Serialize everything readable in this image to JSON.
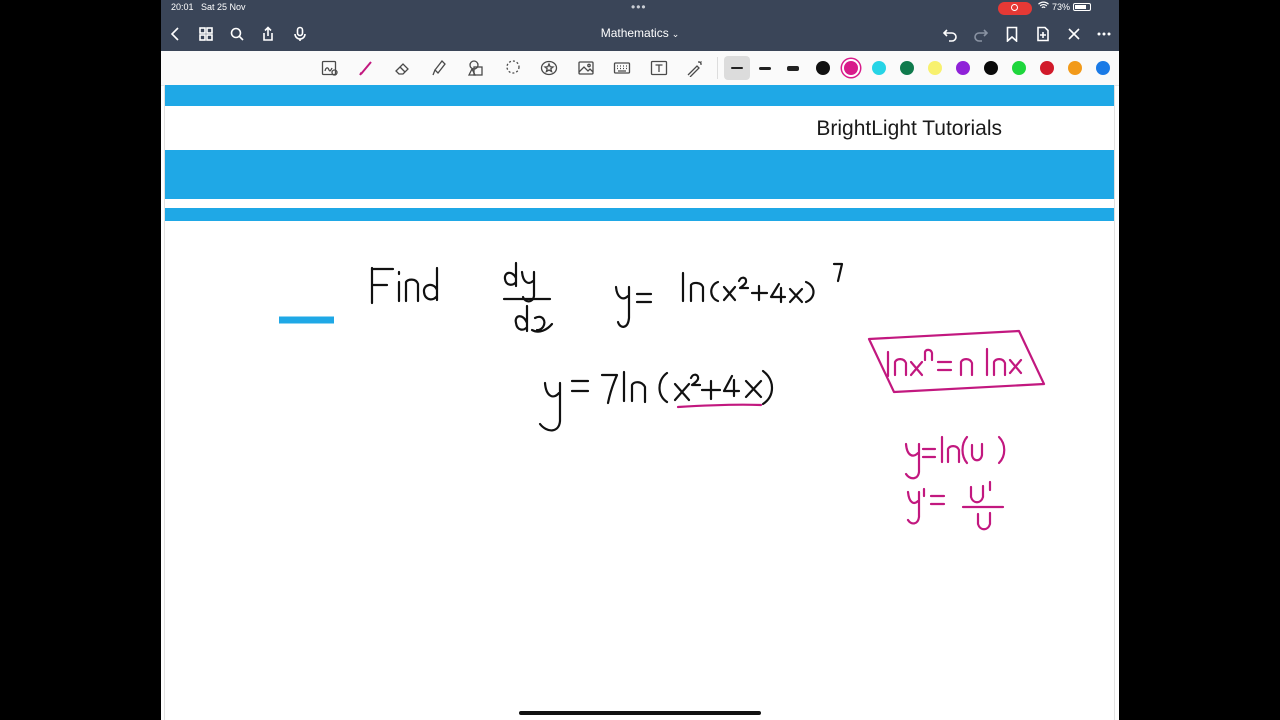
{
  "status": {
    "time": "20:01",
    "date": "Sat 25 Nov",
    "battery": "73%"
  },
  "nav": {
    "title": "Mathematics"
  },
  "page": {
    "brand": "BrightLight Tutorials"
  },
  "colors": {
    "topbar": "#3a4558",
    "accent_band": "#1fa8e6",
    "pen_black": "#111111",
    "pen_magenta": "#c2187f"
  },
  "toolbar": {
    "tools": [
      "zoom-window-icon",
      "pen-icon",
      "eraser-icon",
      "highlighter-icon",
      "shapes-icon",
      "lasso-icon",
      "sticker-icon",
      "image-icon",
      "keyboard-icon",
      "text-icon",
      "laser-pointer-icon"
    ],
    "swatches": [
      "#111111",
      "#d81b8a",
      "#26d4e6",
      "#0f7a4c",
      "#f8f16e",
      "#8f22d8",
      "#0a0a0a",
      "#1ed63c",
      "#d11a2a",
      "#f29a1a",
      "#1a7ae6"
    ],
    "selected_swatch": "#d81b8a"
  }
}
